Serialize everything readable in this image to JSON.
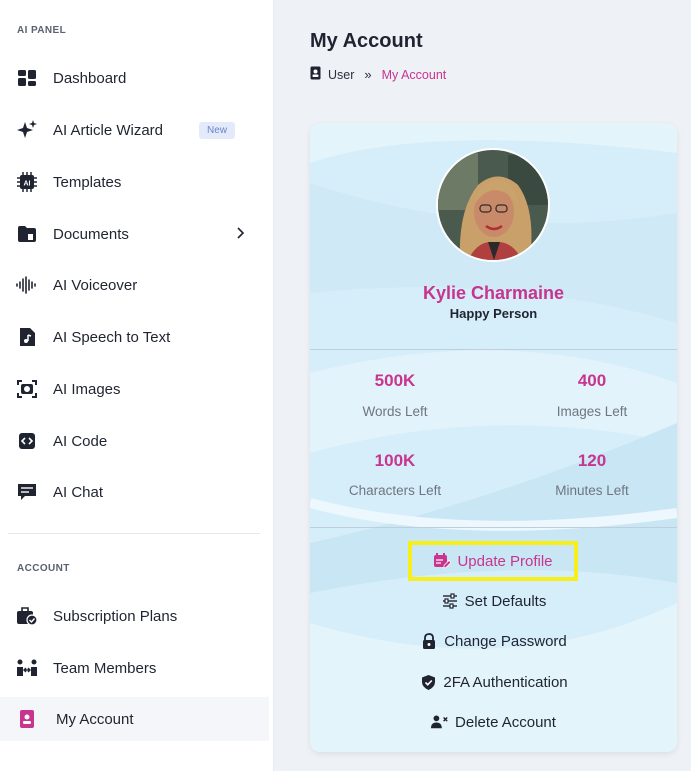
{
  "sidebar": {
    "section_ai": "AI PANEL",
    "section_account": "ACCOUNT",
    "items": [
      {
        "label": "Dashboard",
        "icon": "dashboard-icon"
      },
      {
        "label": "AI Article Wizard",
        "icon": "sparkles-icon",
        "badge": "New"
      },
      {
        "label": "Templates",
        "icon": "ai-chip-icon"
      },
      {
        "label": "Documents",
        "icon": "folder-icon"
      },
      {
        "label": "AI Voiceover",
        "icon": "soundwave-icon"
      },
      {
        "label": "AI Speech to Text",
        "icon": "audio-file-icon"
      },
      {
        "label": "AI Images",
        "icon": "camera-icon"
      },
      {
        "label": "AI Code",
        "icon": "code-icon"
      },
      {
        "label": "AI Chat",
        "icon": "chat-icon"
      }
    ],
    "account_items": [
      {
        "label": "Subscription Plans",
        "icon": "briefcase-check-icon"
      },
      {
        "label": "Team Members",
        "icon": "team-icon"
      },
      {
        "label": "My Account",
        "icon": "id-badge-icon",
        "active": true
      }
    ]
  },
  "header": {
    "title": "My Account",
    "breadcrumb": {
      "user": "User",
      "separator": "»",
      "current": "My Account"
    }
  },
  "profile": {
    "name": "Kylie Charmaine",
    "role": "Happy Person",
    "stats": [
      {
        "value": "500K",
        "label": "Words Left"
      },
      {
        "value": "400",
        "label": "Images Left"
      },
      {
        "value": "100K",
        "label": "Characters Left"
      },
      {
        "value": "120",
        "label": "Minutes Left"
      }
    ],
    "actions": [
      {
        "label": "Update Profile",
        "icon": "calendar-edit-icon"
      },
      {
        "label": "Set Defaults",
        "icon": "sliders-icon"
      },
      {
        "label": "Change Password",
        "icon": "lock-icon"
      },
      {
        "label": "2FA Authentication",
        "icon": "shield-check-icon"
      },
      {
        "label": "Delete Account",
        "icon": "user-remove-icon"
      }
    ]
  },
  "colors": {
    "accent": "#c7358f",
    "highlight": "#f6ef1c",
    "card_bg": "#d9eff9"
  }
}
